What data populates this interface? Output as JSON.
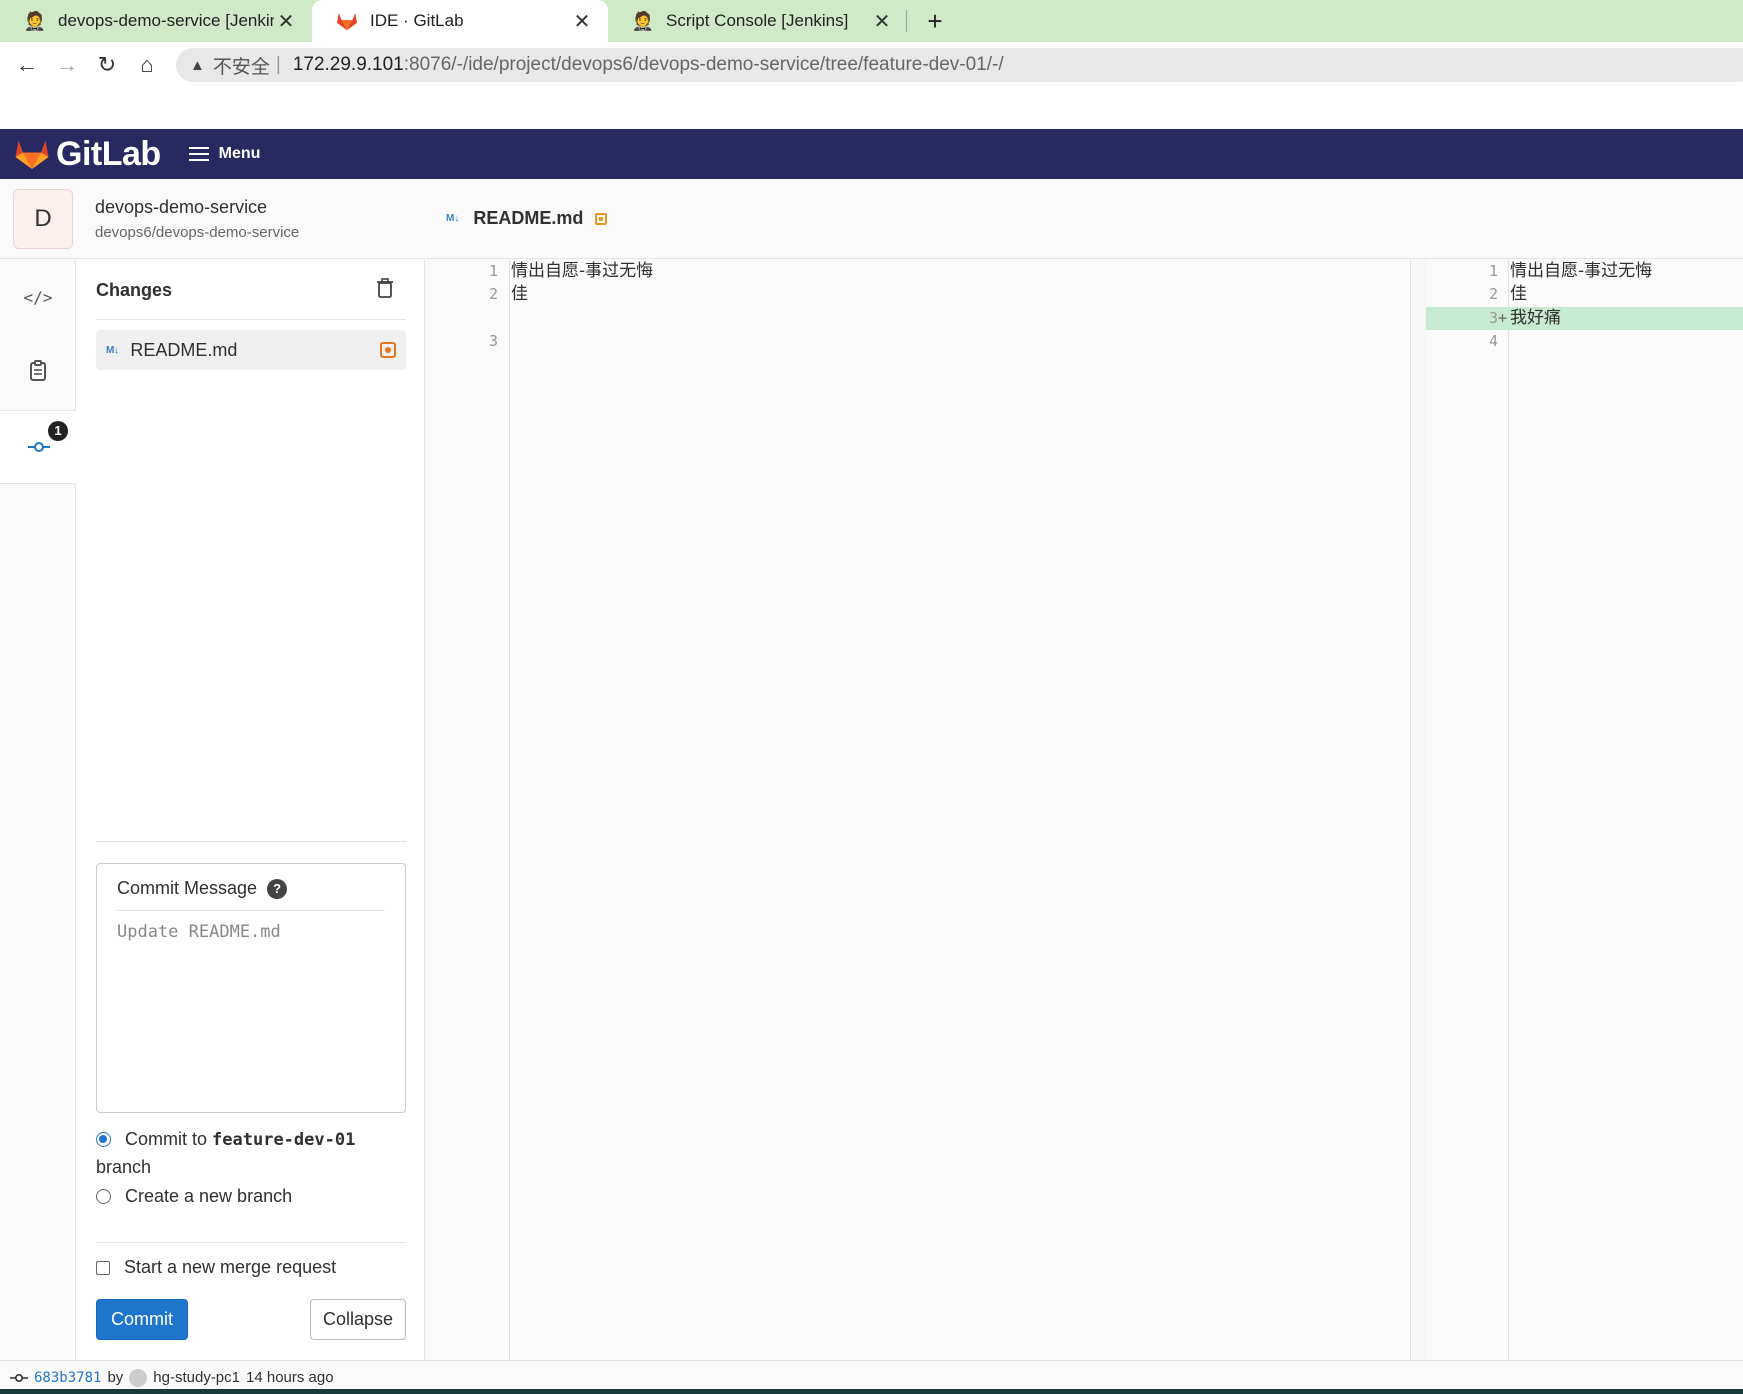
{
  "browser": {
    "tabs": [
      {
        "title": "devops-demo-service [Jenkins]",
        "icon": "jenkins-icon"
      },
      {
        "title": "IDE · GitLab",
        "icon": "gitlab-icon",
        "active": true
      },
      {
        "title": "Script Console [Jenkins]",
        "icon": "jenkins-icon"
      }
    ],
    "url_insecure_label": "不安全",
    "url_host": "172.29.9.101",
    "url_path": ":8076/-/ide/project/devops6/devops-demo-service/tree/feature-dev-01/-/"
  },
  "header": {
    "logo_text": "GitLab",
    "menu_label": "Menu",
    "brand_color": "#292961"
  },
  "project": {
    "avatar_letter": "D",
    "name": "devops-demo-service",
    "path": "devops6/devops-demo-service"
  },
  "activity": {
    "changes_badge": "1"
  },
  "changes": {
    "title": "Changes",
    "file_icon_label": "M↓",
    "file_name": "README.md"
  },
  "commit": {
    "message_label": "Commit Message",
    "help_glyph": "?",
    "placeholder": "Update README.md",
    "commit_to_prefix": "Commit to",
    "branch_name": "feature-dev-01",
    "branch_suffix": "branch",
    "new_branch_label": "Create a new branch",
    "merge_request_label": "Start a new merge request",
    "commit_button": "Commit",
    "collapse_button": "Collapse",
    "accent_color": "#1f75cb"
  },
  "editor": {
    "tab_icon_label": "M↓",
    "tab_name": "README.md",
    "left": [
      {
        "ln": "1",
        "text": "情出自愿-事过无悔"
      },
      {
        "ln": "2",
        "text": "佳"
      },
      {
        "ln": "3",
        "text": ""
      }
    ],
    "right": [
      {
        "ln": "1",
        "text": "情出自愿-事过无悔"
      },
      {
        "ln": "2",
        "text": "佳"
      },
      {
        "ln": "3",
        "text": "我好痛",
        "added": true
      },
      {
        "ln": "4",
        "text": ""
      }
    ],
    "added_color": "#c7ebd0"
  },
  "status": {
    "sha": "683b3781",
    "by": "by",
    "author": "hg-study-pc1",
    "time": "14 hours ago"
  }
}
